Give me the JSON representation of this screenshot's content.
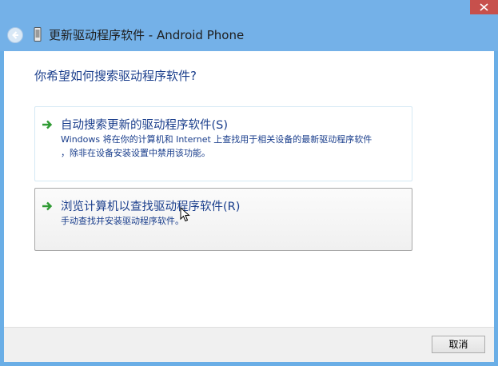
{
  "window": {
    "title": "更新驱动程序软件 - Android Phone",
    "accent_color": "#74b1e8",
    "close_color": "#c7504c"
  },
  "main": {
    "question": "你希望如何搜索驱动程序软件?",
    "options": [
      {
        "title": "自动搜索更新的驱动程序软件(S)",
        "description_line1": "Windows 将在你的计算机和 Internet 上查找用于相关设备的最新驱动程序软件",
        "description_line2": "，除非在设备安装设置中禁用该功能。",
        "icon": "green-arrow-icon"
      },
      {
        "title": "浏览计算机以查找驱动程序软件(R)",
        "description_line1": "手动查找并安装驱动程序软件。",
        "icon": "green-arrow-icon"
      }
    ]
  },
  "footer": {
    "cancel_label": "取消"
  }
}
